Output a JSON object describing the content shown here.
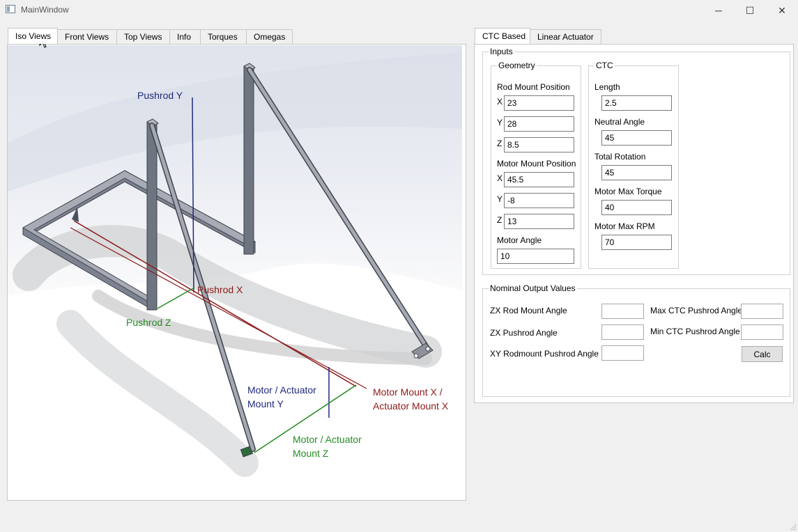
{
  "window": {
    "title": "MainWindow",
    "minimize_glyph": "─",
    "maximize_glyph": "☐",
    "close_glyph": "✕"
  },
  "left_tabs": [
    "Iso Views",
    "Front Views",
    "Top Views",
    "Info",
    "Torques",
    "Omegas"
  ],
  "right_tabs": [
    "CTC Based",
    "Linear Actuator"
  ],
  "diagram": {
    "pushrod_y": "Pushrod Y",
    "pushrod_x": "Pushrod X",
    "pushrod_z": "Pushrod Z",
    "motor_y_line1": "Motor / Actuator",
    "motor_y_line2": "Mount Y",
    "motor_x_line1": "Motor Mount X /",
    "motor_x_line2": "Actuator Mount X",
    "motor_z_line1": "Motor / Actuator",
    "motor_z_line2": "Mount Z"
  },
  "inputs": {
    "title": "Inputs",
    "geometry": {
      "title": "Geometry",
      "rod_mount_label": "Rod Mount Position",
      "motor_mount_label": "Motor Mount Position",
      "x": "X",
      "y": "Y",
      "z": "Z",
      "rod_x": "23",
      "rod_y": "28",
      "rod_z": "8.5",
      "motor_x": "45.5",
      "motor_y": "-8",
      "motor_z": "13",
      "motor_angle_label": "Motor Angle",
      "motor_angle": "10"
    },
    "ctc": {
      "title": "CTC",
      "length_label": "Length",
      "length": "2.5",
      "neutral_angle_label": "Neutral Angle",
      "neutral_angle": "45",
      "total_rotation_label": "Total Rotation",
      "total_rotation": "45",
      "max_torque_label": "Motor Max Torque",
      "max_torque": "40",
      "max_rpm_label": "Motor Max RPM",
      "max_rpm": "70"
    }
  },
  "outputs": {
    "title": "Nominal Output Values",
    "zx_rod_mount_angle_label": "ZX Rod Mount Angle",
    "zx_pushrod_angle_label": "ZX Pushrod Angle",
    "xy_rodmount_pushrod_angle_label": "XY Rodmount Pushrod Angle",
    "max_ctc_label": "Max CTC Pushrod Angle",
    "min_ctc_label": "Min CTC Pushrod Angle",
    "calc_label": "Calc"
  },
  "colors": {
    "blue_label": "#1f2a7a",
    "red_label": "#8b1a1a",
    "green_label": "#238c23",
    "frame_gray": "#6e7480"
  }
}
